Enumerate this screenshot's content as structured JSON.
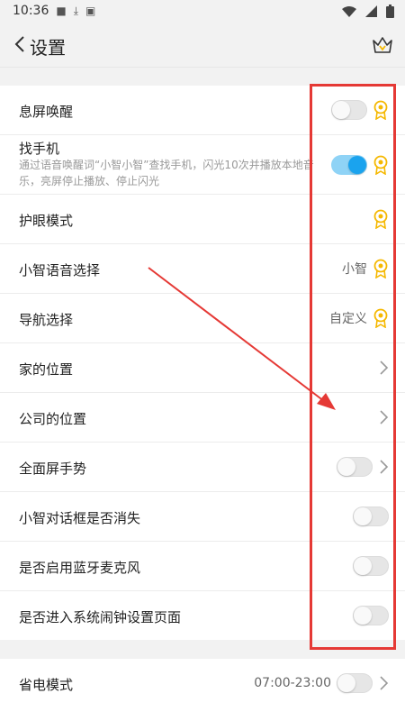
{
  "status": {
    "time": "10:36"
  },
  "header": {
    "title": "设置",
    "back_icon": "chevron-left-icon",
    "crown_icon": "crown-icon"
  },
  "settings": [
    {
      "label": "息屏唤醒",
      "control": "toggle",
      "toggle_on": false,
      "badge": true
    },
    {
      "label": "找手机",
      "desc": "通过语音唤醒词“小智小智”查找手机，闪光10次并播放本地音乐，亮屏停止播放、停止闪光",
      "control": "toggle",
      "toggle_on": true,
      "badge": true
    },
    {
      "label": "护眼模式",
      "control": "none",
      "badge": true
    },
    {
      "label": "小智语音选择",
      "value": "小智",
      "badge": true
    },
    {
      "label": "导航选择",
      "value": "自定义",
      "badge": true
    },
    {
      "label": "家的位置",
      "control": "chevron"
    },
    {
      "label": "公司的位置",
      "control": "chevron"
    },
    {
      "label": "全面屏手势",
      "control": "toggle-chevron",
      "toggle_on": false
    },
    {
      "label": "小智对话框是否消失",
      "control": "toggle",
      "toggle_on": false
    },
    {
      "label": "是否启用蓝牙麦克风",
      "control": "toggle",
      "toggle_on": false
    },
    {
      "label": "是否进入系统闹钟设置页面",
      "control": "toggle",
      "toggle_on": false
    }
  ],
  "power_saving": {
    "label": "省电模式",
    "value": "07:00-23:00",
    "toggle_on": false
  },
  "colors": {
    "accent": "#1aa3ee",
    "badge": "#f5b800",
    "highlight": "#e53935"
  }
}
